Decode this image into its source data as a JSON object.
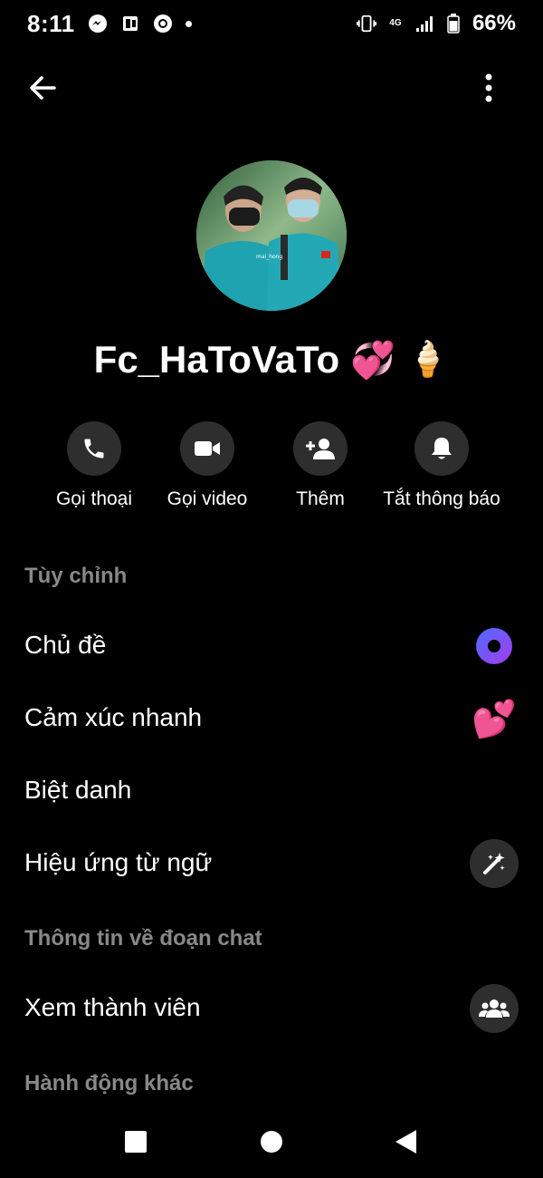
{
  "status_bar": {
    "time": "8:11",
    "battery": "66%",
    "icons": [
      "messenger-icon",
      "outlook-icon",
      "chrome-icon",
      "dot-icon",
      "vibrate-icon",
      "network-4g-icon",
      "signal-icon",
      "battery-icon"
    ],
    "network_label": "4G"
  },
  "header": {
    "back_icon": "arrow-left-icon",
    "more_icon": "more-vertical-icon"
  },
  "profile": {
    "name": "Fc_HaToVaTo",
    "name_emojis": [
      "💞",
      "🍦"
    ],
    "avatar_watermark": "mai_hong"
  },
  "actions": [
    {
      "label": "Gọi thoại",
      "icon": "phone-icon"
    },
    {
      "label": "Gọi video",
      "icon": "video-icon"
    },
    {
      "label": "Thêm",
      "icon": "add-person-icon"
    },
    {
      "label": "Tắt thông báo",
      "icon": "bell-icon"
    }
  ],
  "sections": {
    "customize": {
      "header": "Tùy chỉnh",
      "items": [
        {
          "label": "Chủ đề",
          "icon": "theme-icon"
        },
        {
          "label": "Cảm xúc nhanh",
          "icon": "two-hearts-emoji",
          "emoji": "💕"
        },
        {
          "label": "Biệt danh"
        },
        {
          "label": "Hiệu ứng từ ngữ",
          "icon": "magic-wand-icon"
        }
      ]
    },
    "chat_info": {
      "header": "Thông tin về đoạn chat",
      "items": [
        {
          "label": "Xem thành viên",
          "icon": "group-icon"
        }
      ]
    },
    "other_actions": {
      "header": "Hành động khác"
    }
  },
  "colors": {
    "background": "#000000",
    "circle_bg": "#2e2e2e",
    "section_header": "#888888",
    "theme_gradient_start": "#4f6bff",
    "theme_gradient_end": "#a33cf0"
  },
  "nav_bar": {
    "icons": [
      "recents-square-icon",
      "home-circle-icon",
      "back-triangle-icon"
    ]
  }
}
